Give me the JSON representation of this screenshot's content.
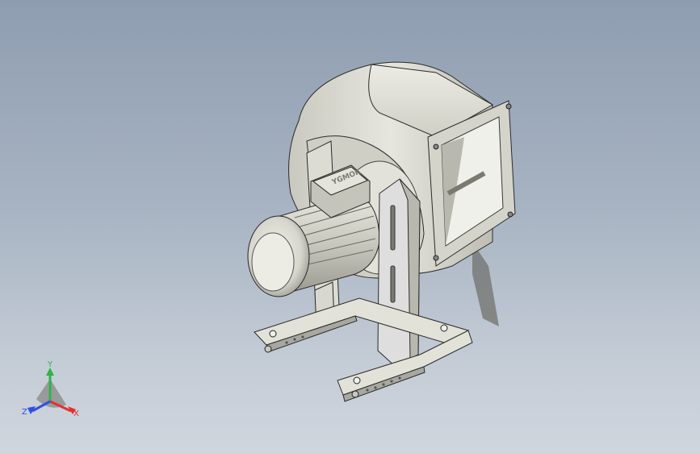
{
  "viewport": {
    "background_top": "#8e9db0",
    "background_bottom": "#d0d6de"
  },
  "model": {
    "motor_label": "YGMOK",
    "part_color": "#d9d9d0",
    "edge_color": "#2a2a2a"
  },
  "triad": {
    "x_label": "X",
    "y_label": "Y",
    "z_label": "Z",
    "x_color": "#e23030",
    "y_color": "#2fb24a",
    "z_color": "#3050e0"
  }
}
